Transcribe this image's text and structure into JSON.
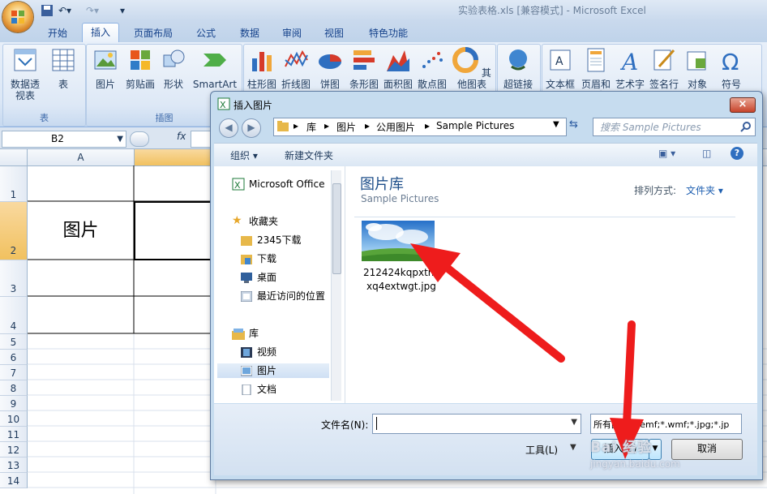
{
  "window": {
    "title": "实验表格.xls  [兼容模式] - Microsoft Excel"
  },
  "ribbon": {
    "tabs": [
      "开始",
      "插入",
      "页面布局",
      "公式",
      "数据",
      "审阅",
      "视图",
      "特色功能"
    ],
    "active_tab": "插入",
    "groups": {
      "table": {
        "label": "表",
        "buttons": [
          "数据透视表",
          "表"
        ]
      },
      "illustrations": {
        "label": "插图",
        "buttons": [
          "图片",
          "剪贴画",
          "形状",
          "SmartArt"
        ]
      },
      "charts": {
        "buttons": [
          "柱形图",
          "折线图",
          "饼图",
          "条形图",
          "面积图",
          "散点图",
          "其他图表"
        ]
      },
      "links": {
        "buttons": [
          "超链接"
        ]
      },
      "text": {
        "buttons": [
          "文本框",
          "页眉和页脚",
          "艺术字",
          "签名行",
          "对象",
          "符号"
        ]
      }
    }
  },
  "formula_bar": {
    "name_box": "B2",
    "fx": "fx"
  },
  "sheet": {
    "columns": [
      "A"
    ],
    "rows": [
      "1",
      "2",
      "3",
      "4",
      "5",
      "6",
      "7",
      "8",
      "9",
      "10",
      "11",
      "12",
      "13",
      "14"
    ],
    "cell_a2": "图片"
  },
  "dialog": {
    "title": "插入图片",
    "close": "×",
    "breadcrumb": [
      "库",
      "图片",
      "公用图片",
      "Sample Pictures"
    ],
    "search_placeholder": "搜索 Sample Pictures",
    "toolbar": {
      "organize": "组织 ▾",
      "new_folder": "新建文件夹"
    },
    "nav": {
      "office": "Microsoft Office",
      "favorites": "收藏夹",
      "fav_items": [
        "2345下载",
        "下载",
        "桌面",
        "最近访问的位置"
      ],
      "libraries": "库",
      "lib_items": [
        "视频",
        "图片",
        "文档"
      ]
    },
    "library_title": "图片库",
    "library_sub": "Sample Pictures",
    "arrange_label": "排列方式:",
    "arrange_value": "文件夹 ▾",
    "file": {
      "name_line1": "212424kqpxtm",
      "name_line2": "xq4extwgt.jpg"
    },
    "filename_label": "文件名(N):",
    "filter_text": "所有图片(*.emf;*.wmf;*.jpg;*.jp",
    "tools": "工具(L)",
    "insert": "插入(S)",
    "cancel": "取消"
  },
  "watermark": {
    "line1": "Bai 经验",
    "line2": "jingyan.baidu.com"
  },
  "colors": {
    "accent": "#15428b",
    "arrow": "#ee1c1c",
    "sel_header": "#f1c15f"
  }
}
